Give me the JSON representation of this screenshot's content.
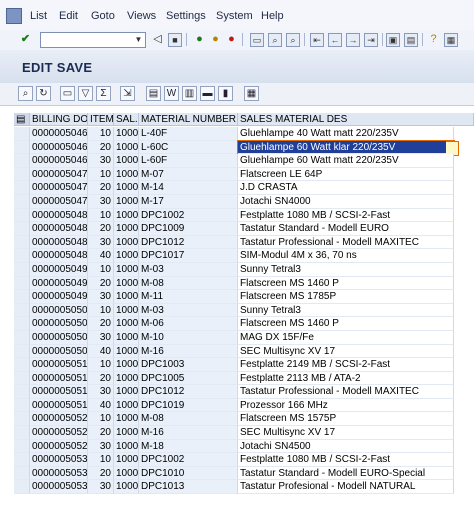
{
  "menu": {
    "items": [
      {
        "label": "List",
        "underline": "L"
      },
      {
        "label": "Edit",
        "underline": "E"
      },
      {
        "label": "Goto",
        "underline": "G"
      },
      {
        "label": "Views",
        "underline": "V"
      },
      {
        "label": "Settings",
        "underline": "S"
      },
      {
        "label": "System",
        "underline": "y"
      },
      {
        "label": "Help",
        "underline": "H"
      }
    ]
  },
  "toolbar": {
    "command_field_value": "",
    "icons": [
      "enter-icon",
      "back-icon",
      "save-icon",
      "back-arrow-icon",
      "exit-icon",
      "cancel-icon",
      "print-icon",
      "find-icon",
      "find-next-icon",
      "first-page-icon",
      "previous-page-icon",
      "next-page-icon",
      "last-page-icon",
      "new-session-icon",
      "shortcut-icon",
      "help-icon",
      "layout-icon"
    ]
  },
  "title": "EDIT SAVE",
  "app_toolbar": {
    "icons": [
      "details-icon",
      "refresh-icon",
      "print-icon",
      "filter-icon",
      "total-icon",
      "export-icon",
      "spreadsheet-icon",
      "word-icon",
      "local-file-icon",
      "abc-analysis-icon",
      "graphic-icon",
      "layout-icon"
    ]
  },
  "table": {
    "columns": [
      "BILLING DOC",
      "ITEM",
      "SAL...",
      "MATERIAL NUMBER",
      "SALES MATERIAL DES"
    ],
    "active_row": 1,
    "rows": [
      [
        "0000005046",
        "10",
        "1000",
        "L-40F",
        "Gluehlampe 40 Watt matt 220/235V"
      ],
      [
        "0000005046",
        "20",
        "1000",
        "L-60C",
        "Gluehlampe 60 Watt klar 220/235V"
      ],
      [
        "0000005046",
        "30",
        "1000",
        "L-60F",
        "Gluehlampe 60 Watt matt 220/235V"
      ],
      [
        "0000005047",
        "10",
        "1000",
        "M-07",
        "Flatscreen LE 64P"
      ],
      [
        "0000005047",
        "20",
        "1000",
        "M-14",
        "J.D CRASTA"
      ],
      [
        "0000005047",
        "30",
        "1000",
        "M-17",
        "Jotachi SN4000"
      ],
      [
        "0000005048",
        "10",
        "1000",
        "DPC1002",
        "Festplatte 1080 MB / SCSI-2-Fast"
      ],
      [
        "0000005048",
        "20",
        "1000",
        "DPC1009",
        "Tastatur Standard - Modell EURO"
      ],
      [
        "0000005048",
        "30",
        "1000",
        "DPC1012",
        "Tastatur Professional - Modell MAXITEC"
      ],
      [
        "0000005048",
        "40",
        "1000",
        "DPC1017",
        "SIM-Modul 4M x 36, 70 ns"
      ],
      [
        "0000005049",
        "10",
        "1000",
        "M-03",
        "Sunny Tetral3"
      ],
      [
        "0000005049",
        "20",
        "1000",
        "M-08",
        "Flatscreen MS 1460 P"
      ],
      [
        "0000005049",
        "30",
        "1000",
        "M-11",
        "Flatscreen MS 1785P"
      ],
      [
        "0000005050",
        "10",
        "1000",
        "M-03",
        "Sunny Tetral3"
      ],
      [
        "0000005050",
        "20",
        "1000",
        "M-06",
        "Flatscreen MS 1460 P"
      ],
      [
        "0000005050",
        "30",
        "1000",
        "M-10",
        "MAG DX 15F/Fe"
      ],
      [
        "0000005050",
        "40",
        "1000",
        "M-16",
        "SEC Multisync XV 17"
      ],
      [
        "0000005051",
        "10",
        "1000",
        "DPC1003",
        "Festplatte 2149 MB / SCSI-2-Fast"
      ],
      [
        "0000005051",
        "20",
        "1000",
        "DPC1005",
        "Festplatte 2113 MB /  ATA-2"
      ],
      [
        "0000005051",
        "30",
        "1000",
        "DPC1012",
        "Tastatur Professional - Modell MAXITEC"
      ],
      [
        "0000005051",
        "40",
        "1000",
        "DPC1019",
        "Prozessor 166 MHz"
      ],
      [
        "0000005052",
        "10",
        "1000",
        "M-08",
        "Flatscreen MS 1575P"
      ],
      [
        "0000005052",
        "20",
        "1000",
        "M-16",
        "SEC Multisync XV 17"
      ],
      [
        "0000005052",
        "30",
        "1000",
        "M-18",
        "Jotachi SN4500"
      ],
      [
        "0000005053",
        "10",
        "1000",
        "DPC1002",
        "Festplatte 1080 MB / SCSI-2-Fast"
      ],
      [
        "0000005053",
        "20",
        "1000",
        "DPC1010",
        "Tastatur Standard - Modell EURO-Special"
      ],
      [
        "0000005053",
        "30",
        "1000",
        "DPC1013",
        "Tastatur Profesional - Modell NATURAL"
      ]
    ]
  }
}
